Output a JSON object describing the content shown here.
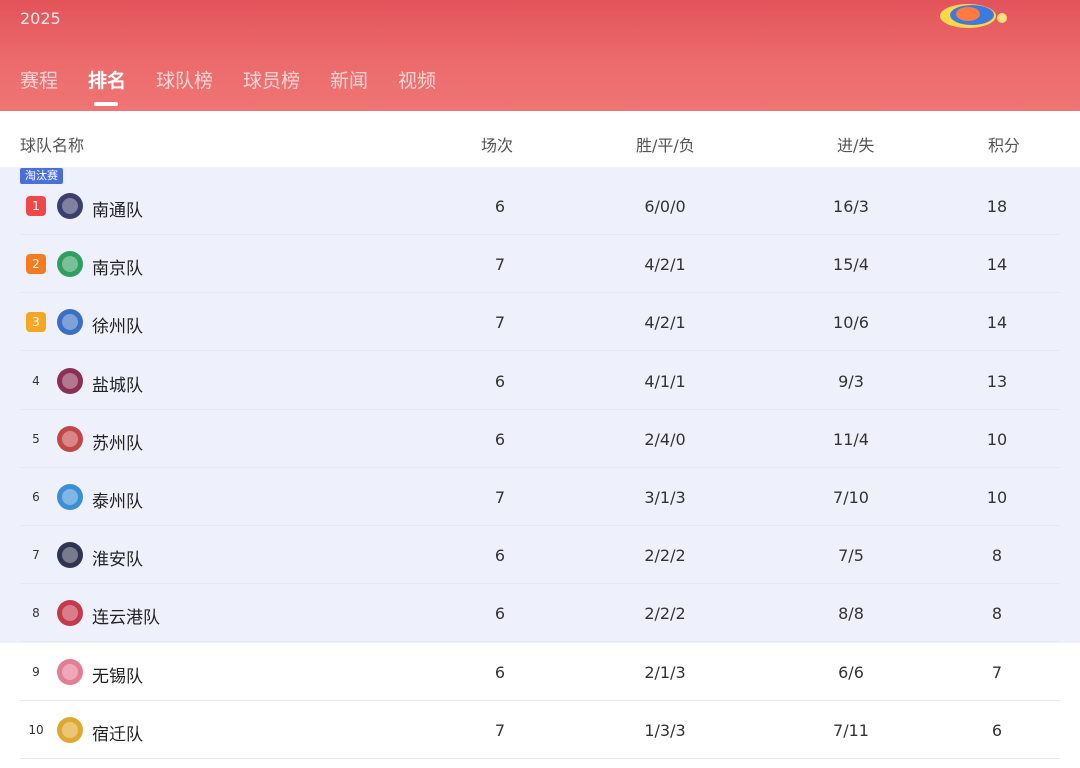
{
  "header": {
    "year": "2025",
    "tabs": [
      {
        "label": "赛程",
        "active": false
      },
      {
        "label": "排名",
        "active": true
      },
      {
        "label": "球队榜",
        "active": false
      },
      {
        "label": "球员榜",
        "active": false
      },
      {
        "label": "新闻",
        "active": false
      },
      {
        "label": "视频",
        "active": false
      }
    ],
    "accent": "#e85a5f"
  },
  "table": {
    "columns": [
      "球队名称",
      "场次",
      "胜/平/负",
      "进/失",
      "积分"
    ],
    "badge": "淘汰赛",
    "rows": [
      {
        "rank": "1",
        "team": "南通队",
        "played": "6",
        "wdl": "6/0/0",
        "gf_ga": "16/3",
        "pts": "18",
        "crest_icon": "nantong-crest-icon"
      },
      {
        "rank": "2",
        "team": "南京队",
        "played": "7",
        "wdl": "4/2/1",
        "gf_ga": "15/4",
        "pts": "14",
        "crest_icon": "nanjing-crest-icon"
      },
      {
        "rank": "3",
        "team": "徐州队",
        "played": "7",
        "wdl": "4/2/1",
        "gf_ga": "10/6",
        "pts": "14",
        "crest_icon": "xuzhou-crest-icon"
      },
      {
        "rank": "4",
        "team": "盐城队",
        "played": "6",
        "wdl": "4/1/1",
        "gf_ga": "9/3",
        "pts": "13",
        "crest_icon": "yancheng-crest-icon"
      },
      {
        "rank": "5",
        "team": "苏州队",
        "played": "6",
        "wdl": "2/4/0",
        "gf_ga": "11/4",
        "pts": "10",
        "crest_icon": "suzhou-crest-icon"
      },
      {
        "rank": "6",
        "team": "泰州队",
        "played": "7",
        "wdl": "3/1/3",
        "gf_ga": "7/10",
        "pts": "10",
        "crest_icon": "taizhou-crest-icon"
      },
      {
        "rank": "7",
        "team": "淮安队",
        "played": "6",
        "wdl": "2/2/2",
        "gf_ga": "7/5",
        "pts": "8",
        "crest_icon": "huaian-crest-icon"
      },
      {
        "rank": "8",
        "team": "连云港队",
        "played": "6",
        "wdl": "2/2/2",
        "gf_ga": "8/8",
        "pts": "8",
        "crest_icon": "lianyungang-crest-icon"
      },
      {
        "rank": "9",
        "team": "无锡队",
        "played": "6",
        "wdl": "2/1/3",
        "gf_ga": "6/6",
        "pts": "7",
        "crest_icon": "wuxi-crest-icon"
      },
      {
        "rank": "10",
        "team": "宿迁队",
        "played": "7",
        "wdl": "1/3/3",
        "gf_ga": "7/11",
        "pts": "6",
        "crest_icon": "suqian-crest-icon"
      }
    ]
  }
}
